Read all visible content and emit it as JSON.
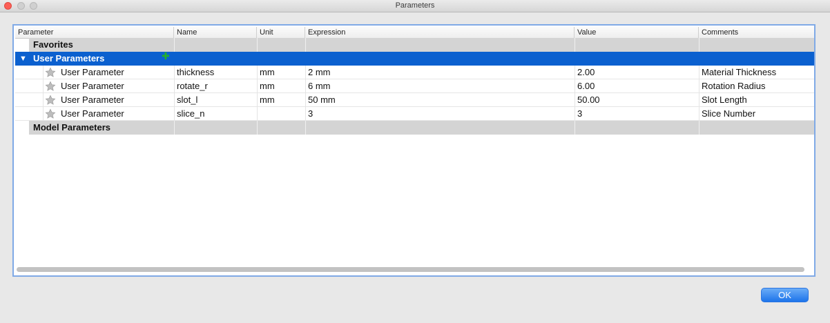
{
  "window": {
    "title": "Parameters"
  },
  "columns": [
    "Parameter",
    "Name",
    "Unit",
    "Expression",
    "Value",
    "Comments"
  ],
  "groups": {
    "favorites": {
      "label": "Favorites"
    },
    "user": {
      "label": "User Parameters",
      "add_icon": "plus-icon"
    },
    "model": {
      "label": "Model Parameters"
    }
  },
  "rows": [
    {
      "type": "User Parameter",
      "name": "thickness",
      "unit": "mm",
      "expression": "2 mm",
      "value": "2.00",
      "comment": "Material Thickness"
    },
    {
      "type": "User Parameter",
      "name": "rotate_r",
      "unit": "mm",
      "expression": "6 mm",
      "value": "6.00",
      "comment": "Rotation Radius"
    },
    {
      "type": "User Parameter",
      "name": "slot_l",
      "unit": "mm",
      "expression": "50 mm",
      "value": "50.00",
      "comment": "Slot Length"
    },
    {
      "type": "User Parameter",
      "name": "slice_n",
      "unit": "",
      "expression": "3",
      "value": "3",
      "comment": "Slice Number"
    }
  ],
  "buttons": {
    "ok": "OK"
  },
  "colors": {
    "selection": "#0b60cf",
    "group_bg": "#d4d4d4",
    "frame": "#7fa9e6",
    "add": "#22b02a"
  }
}
